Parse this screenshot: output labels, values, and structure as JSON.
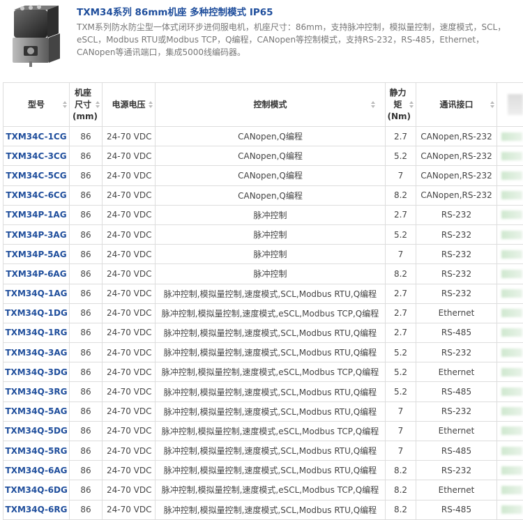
{
  "header": {
    "title": "TXM34系列 86mm机座 多种控制模式 IP65",
    "description": "TXM系列防水防尘型一体式闭环步进伺服电机，机座尺寸：86mm，支持脉冲控制，模拟量控制，速度模式，SCL，eSCL，Modbus RTU或Modbus TCP，Q编程，CANopen等控制模式，支持RS-232，RS-485，Ethernet，CANopen等通讯端口，集成5000线编码器。"
  },
  "table": {
    "columns": [
      "型号",
      "机座尺寸(mm)",
      "电源电压",
      "控制模式",
      "静力矩(Nm)",
      "通讯接口"
    ],
    "rows": [
      {
        "model": "TXM34C-1CG",
        "size": "86",
        "voltage": "24-70 VDC",
        "control": "CANopen,Q编程",
        "torque": "2.7",
        "comm": "CANopen,RS-232"
      },
      {
        "model": "TXM34C-3CG",
        "size": "86",
        "voltage": "24-70 VDC",
        "control": "CANopen,Q编程",
        "torque": "5.2",
        "comm": "CANopen,RS-232"
      },
      {
        "model": "TXM34C-5CG",
        "size": "86",
        "voltage": "24-70 VDC",
        "control": "CANopen,Q编程",
        "torque": "7",
        "comm": "CANopen,RS-232"
      },
      {
        "model": "TXM34C-6CG",
        "size": "86",
        "voltage": "24-70 VDC",
        "control": "CANopen,Q编程",
        "torque": "8.2",
        "comm": "CANopen,RS-232"
      },
      {
        "model": "TXM34P-1AG",
        "size": "86",
        "voltage": "24-70 VDC",
        "control": "脉冲控制",
        "torque": "2.7",
        "comm": "RS-232"
      },
      {
        "model": "TXM34P-3AG",
        "size": "86",
        "voltage": "24-70 VDC",
        "control": "脉冲控制",
        "torque": "5.2",
        "comm": "RS-232"
      },
      {
        "model": "TXM34P-5AG",
        "size": "86",
        "voltage": "24-70 VDC",
        "control": "脉冲控制",
        "torque": "7",
        "comm": "RS-232"
      },
      {
        "model": "TXM34P-6AG",
        "size": "86",
        "voltage": "24-70 VDC",
        "control": "脉冲控制",
        "torque": "8.2",
        "comm": "RS-232"
      },
      {
        "model": "TXM34Q-1AG",
        "size": "86",
        "voltage": "24-70 VDC",
        "control": "脉冲控制,模拟量控制,速度模式,SCL,Modbus RTU,Q编程",
        "torque": "2.7",
        "comm": "RS-232"
      },
      {
        "model": "TXM34Q-1DG",
        "size": "86",
        "voltage": "24-70 VDC",
        "control": "脉冲控制,模拟量控制,速度模式,eSCL,Modbus TCP,Q编程",
        "torque": "2.7",
        "comm": "Ethernet"
      },
      {
        "model": "TXM34Q-1RG",
        "size": "86",
        "voltage": "24-70 VDC",
        "control": "脉冲控制,模拟量控制,速度模式,SCL,Modbus RTU,Q编程",
        "torque": "2.7",
        "comm": "RS-485"
      },
      {
        "model": "TXM34Q-3AG",
        "size": "86",
        "voltage": "24-70 VDC",
        "control": "脉冲控制,模拟量控制,速度模式,SCL,Modbus RTU,Q编程",
        "torque": "5.2",
        "comm": "RS-232"
      },
      {
        "model": "TXM34Q-3DG",
        "size": "86",
        "voltage": "24-70 VDC",
        "control": "脉冲控制,模拟量控制,速度模式,eSCL,Modbus TCP,Q编程",
        "torque": "5.2",
        "comm": "Ethernet"
      },
      {
        "model": "TXM34Q-3RG",
        "size": "86",
        "voltage": "24-70 VDC",
        "control": "脉冲控制,模拟量控制,速度模式,SCL,Modbus RTU,Q编程",
        "torque": "5.2",
        "comm": "RS-485"
      },
      {
        "model": "TXM34Q-5AG",
        "size": "86",
        "voltage": "24-70 VDC",
        "control": "脉冲控制,模拟量控制,速度模式,SCL,Modbus RTU,Q编程",
        "torque": "7",
        "comm": "RS-232"
      },
      {
        "model": "TXM34Q-5DG",
        "size": "86",
        "voltage": "24-70 VDC",
        "control": "脉冲控制,模拟量控制,速度模式,eSCL,Modbus TCP,Q编程",
        "torque": "7",
        "comm": "Ethernet"
      },
      {
        "model": "TXM34Q-5RG",
        "size": "86",
        "voltage": "24-70 VDC",
        "control": "脉冲控制,模拟量控制,速度模式,SCL,Modbus RTU,Q编程",
        "torque": "7",
        "comm": "RS-485"
      },
      {
        "model": "TXM34Q-6AG",
        "size": "86",
        "voltage": "24-70 VDC",
        "control": "脉冲控制,模拟量控制,速度模式,SCL,Modbus RTU,Q编程",
        "torque": "8.2",
        "comm": "RS-232"
      },
      {
        "model": "TXM34Q-6DG",
        "size": "86",
        "voltage": "24-70 VDC",
        "control": "脉冲控制,模拟量控制,速度模式,eSCL,Modbus TCP,Q编程",
        "torque": "8.2",
        "comm": "Ethernet"
      },
      {
        "model": "TXM34Q-6RG",
        "size": "86",
        "voltage": "24-70 VDC",
        "control": "脉冲控制,模拟量控制,速度模式,SCL,Modbus RTU,Q编程",
        "torque": "8.2",
        "comm": "RS-485"
      }
    ]
  },
  "colors": {
    "title": "#1f4e9c",
    "model_link": "#1f4e9c",
    "border": "#dddddd",
    "blurred_cell": "#cfe8cf"
  },
  "icons": {
    "sort": "sort-arrows-icon",
    "product": "motor-product-image"
  }
}
